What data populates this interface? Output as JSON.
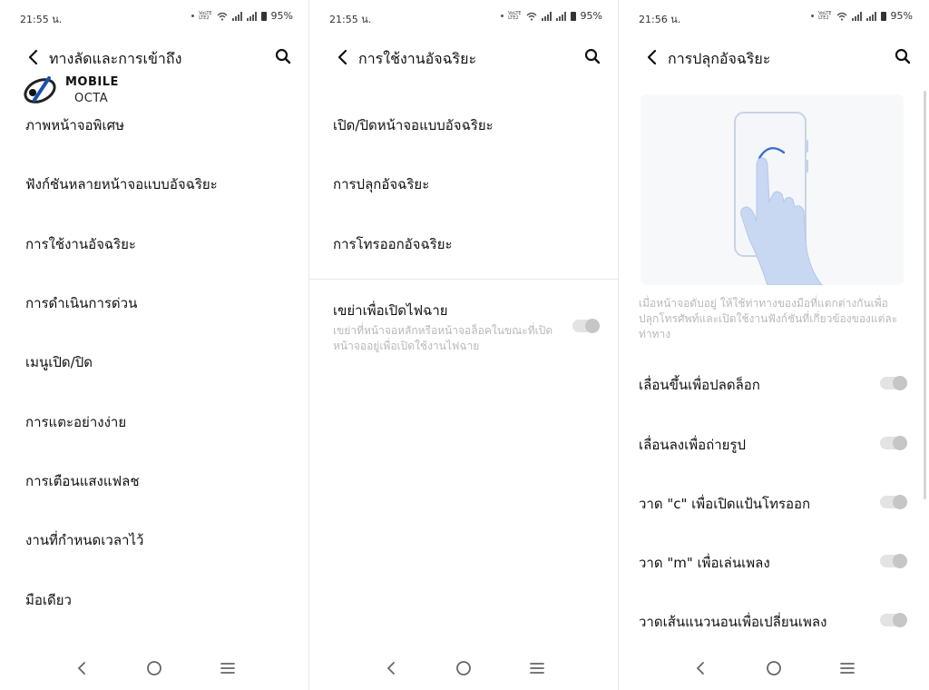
{
  "watermark": {
    "line1": "MOBILE",
    "line2": "OCTA"
  },
  "screens": [
    {
      "status": {
        "time": "21:55 น.",
        "volte_top": "VoLTE",
        "volte_bottom": "LTE2",
        "battery": "95%"
      },
      "header": {
        "title": "ทางลัดและการเข้าถึง"
      },
      "items": [
        "ภาพหน้าจอพิเศษ",
        "ฟังก์ชันหลายหน้าจอแบบอัจฉริยะ",
        "การใช้งานอัจฉริยะ",
        "การดำเนินการด่วน",
        "เมนูเปิด/ปิด",
        "การแตะอย่างง่าย",
        "การเตือนแสงแฟลช",
        "งานที่กำหนดเวลาไว้",
        "มือเดียว"
      ]
    },
    {
      "status": {
        "time": "21:55 น.",
        "volte_top": "VoLTE",
        "volte_bottom": "LTE2",
        "battery": "95%"
      },
      "header": {
        "title": "การใช้งานอัจฉริยะ"
      },
      "items": [
        "เปิด/ปิดหน้าจอแบบอัจฉริยะ",
        "การปลุกอัจฉริยะ",
        "การโทรออกอัจฉริยะ"
      ],
      "toggle_item": {
        "title": "เขย่าเพื่อเปิดไฟฉาย",
        "description": "เขย่าที่หน้าจอหลักหรือหน้าจอล็อคในขณะที่เปิดหน้าจออยู่เพื่อเปิดใช้งานไฟฉาย",
        "enabled": false
      }
    },
    {
      "status": {
        "time": "21:56 น.",
        "volte_top": "VoLTE",
        "volte_bottom": "LTE2",
        "battery": "95%"
      },
      "header": {
        "title": "การปลุกอัจฉริยะ"
      },
      "description": "เมื่อหน้าจอดับอยู่ ให้ใช้ท่าทางของมือที่แตกต่างกันเพื่อปลุกโทรศัพท์และเปิดใช้งานฟังก์ชันที่เกี่ยวข้องของแต่ละท่าทาง",
      "toggles": [
        {
          "label": "เลื่อนขึ้นเพื่อปลดล็อก",
          "enabled": false
        },
        {
          "label": "เลื่อนลงเพื่อถ่ายรูป",
          "enabled": false
        },
        {
          "label": "วาด \"c\" เพื่อเปิดแป้นโทรออก",
          "enabled": false
        },
        {
          "label": "วาด \"m\" เพื่อเล่นเพลง",
          "enabled": false
        },
        {
          "label": "วาดเส้นแนวนอนเพื่อเปลี่ยนเพลง",
          "enabled": false
        }
      ]
    }
  ],
  "icons": {
    "back": "chevron-left-icon",
    "search": "search-icon",
    "nav_back": "nav-back-icon",
    "nav_home": "nav-home-icon",
    "nav_menu": "nav-menu-icon"
  },
  "colors": {
    "background": "#ffffff",
    "text": "#111111",
    "muted_text": "#b9b9b9",
    "toggle_off_track": "#e3e3e3",
    "toggle_off_knob": "#c6c6c6",
    "illustration_hand": "#c9d8f2",
    "illustration_stroke": "#3b6fd1"
  }
}
